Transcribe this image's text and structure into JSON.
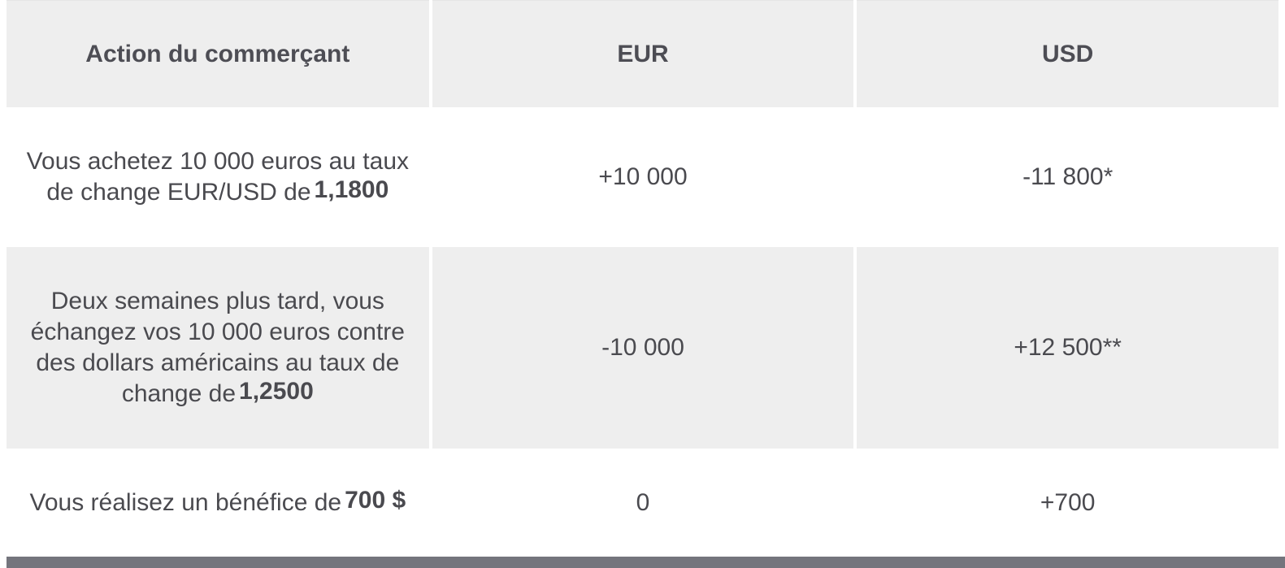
{
  "headers": {
    "action": "Action du commerçant",
    "eur": "EUR",
    "usd": "USD"
  },
  "rows": [
    {
      "action_text": "Vous achetez 10 000 euros au taux de change EUR/USD de",
      "action_emphasis": "1,1800",
      "eur": "+10 000",
      "usd": "-11 800*"
    },
    {
      "action_text": "Deux semaines plus tard, vous échangez vos 10 000 euros contre des dollars américains au taux de change de",
      "action_emphasis": "1,2500",
      "eur": "-10 000",
      "usd": "+12 500**"
    },
    {
      "action_text": "Vous réalisez un bénéfice de",
      "action_emphasis": "700 $",
      "eur": "0",
      "usd": "+700"
    }
  ],
  "colors": {
    "header_bg": "#eeeeee",
    "text": "#4a4a4f",
    "footer_bar": "#74757d"
  }
}
